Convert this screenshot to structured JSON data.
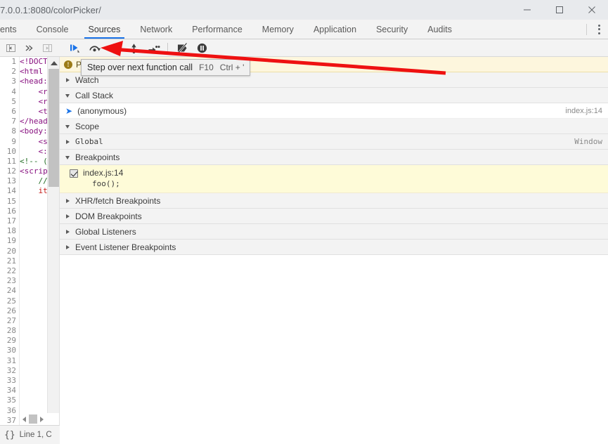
{
  "window": {
    "url_text": "7.0.0.1:8080/colorPicker/",
    "controls": [
      {
        "name": "minimize",
        "label": "—"
      },
      {
        "name": "maximize",
        "label": "□"
      },
      {
        "name": "close",
        "label": "✕"
      }
    ]
  },
  "tabs": [
    {
      "label": "ents",
      "active": false,
      "clipped": true
    },
    {
      "label": "Console",
      "active": false
    },
    {
      "label": "Sources",
      "active": true
    },
    {
      "label": "Network",
      "active": false
    },
    {
      "label": "Performance",
      "active": false
    },
    {
      "label": "Memory",
      "active": false
    },
    {
      "label": "Application",
      "active": false
    },
    {
      "label": "Security",
      "active": false
    },
    {
      "label": "Audits",
      "active": false
    }
  ],
  "navigator_toolbar": [
    {
      "name": "show-navigator-icon",
      "title": "Show navigator"
    },
    {
      "name": "more-tabs-icon",
      "title": "More tabs"
    },
    {
      "name": "show-debugger-icon",
      "title": "Show debugger"
    }
  ],
  "debugger_toolbar": [
    {
      "name": "resume-script-execution-icon",
      "title": "Resume script execution"
    },
    {
      "name": "step-over-next-function-call-icon",
      "title": "Step over next function call"
    },
    {
      "name": "step-into-next-function-call-icon",
      "title": "Step into next function call"
    },
    {
      "name": "step-out-of-current-function-icon",
      "title": "Step out of current function"
    },
    {
      "name": "step-icon",
      "title": "Step"
    },
    {
      "name": "deactivate-breakpoints-icon",
      "title": "Deactivate breakpoints"
    },
    {
      "name": "pause-on-exceptions-icon",
      "title": "Pause on exceptions"
    }
  ],
  "tooltip": {
    "text": "Step over next function call",
    "key1": "F10",
    "key2": "Ctrl + '"
  },
  "editor": {
    "line_numbers": [
      1,
      2,
      3,
      4,
      5,
      6,
      7,
      8,
      9,
      10,
      11,
      12,
      13,
      14,
      15,
      16,
      17,
      18,
      19,
      20,
      21,
      22,
      23,
      24,
      25,
      26,
      27,
      28,
      29,
      30,
      31,
      32,
      33,
      34,
      35,
      36,
      37
    ],
    "lines": [
      {
        "n": 1,
        "text": "<!DOCT",
        "kind": "tag"
      },
      {
        "n": 2,
        "text": "<html",
        "kind": "tag"
      },
      {
        "n": 3,
        "text": "<head:",
        "kind": "tag"
      },
      {
        "n": 4,
        "text": "    <r",
        "kind": "tag"
      },
      {
        "n": 5,
        "text": "    <r",
        "kind": "tag"
      },
      {
        "n": 6,
        "text": "    <t",
        "kind": "tag"
      },
      {
        "n": 7,
        "text": "</head",
        "kind": "tag"
      },
      {
        "n": 8,
        "text": "<body:",
        "kind": "tag"
      },
      {
        "n": 9,
        "text": "    <s",
        "kind": "tag"
      },
      {
        "n": 10,
        "text": "    <:",
        "kind": "tag"
      },
      {
        "n": 11,
        "text": "<!-- (",
        "kind": "comment"
      },
      {
        "n": 12,
        "text": "<scrip",
        "kind": "tag"
      },
      {
        "n": 13,
        "text": "    //",
        "kind": "comment"
      },
      {
        "n": 14,
        "text": "    it",
        "kind": "js"
      }
    ]
  },
  "status_bar": {
    "pretty_print_icon": "{}",
    "position_text": "Line 1, C"
  },
  "sidebar": {
    "paused_banner": {
      "icon": "info-icon",
      "text": "Paused on breakpoint"
    },
    "sections": [
      {
        "name": "watch",
        "label": "Watch",
        "expanded": false,
        "right": ""
      },
      {
        "name": "call-stack",
        "label": "Call Stack",
        "expanded": true,
        "right": ""
      },
      {
        "name": "scope",
        "label": "Scope",
        "expanded": true,
        "right": ""
      },
      {
        "name": "breakpoints",
        "label": "Breakpoints",
        "expanded": true,
        "right": ""
      },
      {
        "name": "xhr-fetch-breakpoints",
        "label": "XHR/fetch Breakpoints",
        "expanded": false,
        "right": ""
      },
      {
        "name": "dom-breakpoints",
        "label": "DOM Breakpoints",
        "expanded": false,
        "right": ""
      },
      {
        "name": "global-listeners",
        "label": "Global Listeners",
        "expanded": false,
        "right": ""
      },
      {
        "name": "event-listener-breakpoints",
        "label": "Event Listener Breakpoints",
        "expanded": false,
        "right": ""
      }
    ],
    "call_stack": {
      "frame_label": "(anonymous)",
      "frame_location": "index.js:14"
    },
    "scope": {
      "entry_label": "Global",
      "entry_value": "Window"
    },
    "breakpoint": {
      "checked": true,
      "file": "index.js:14",
      "code": "foo();"
    }
  },
  "annotation": {
    "arrow_color": "#ee1111"
  }
}
